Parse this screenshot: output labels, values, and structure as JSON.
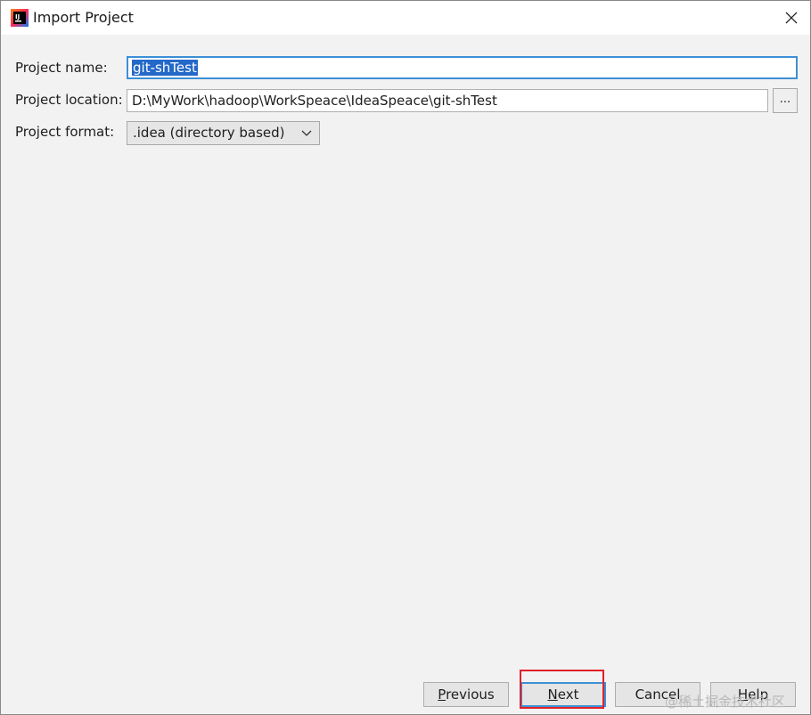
{
  "window": {
    "title": "Import Project",
    "app_icon": "intellij-idea-icon",
    "close_icon": "close-icon"
  },
  "form": {
    "project_name_label": "Project name:",
    "project_name_value": "git-shTest",
    "project_location_label": "Project location:",
    "project_location_value": "D:\\MyWork\\hadoop\\WorkSpeace\\IdeaSpeace\\git-shTest",
    "browse_label": "...",
    "project_format_label": "Project format:",
    "project_format_value": ".idea (directory based)"
  },
  "buttons": {
    "previous": {
      "mnemonic": "P",
      "rest": "revious"
    },
    "next": {
      "mnemonic": "N",
      "rest": "ext"
    },
    "cancel": "Cancel",
    "help": {
      "mnemonic": "H",
      "rest": "elp"
    }
  },
  "watermark": "@稀土掘金技术社区",
  "colors": {
    "focus": "#3d8fd6",
    "selection": "#2468c9",
    "annotation": "#e0202a"
  }
}
